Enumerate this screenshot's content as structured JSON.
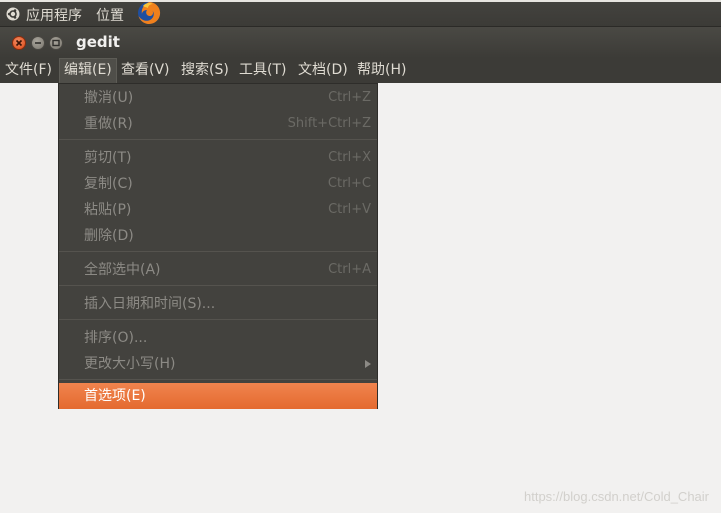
{
  "top_panel": {
    "applications": "应用程序",
    "places": "位置",
    "launcher_icon": "firefox-icon"
  },
  "window": {
    "title": "gedit",
    "buttons": [
      "close-icon",
      "minimize-icon",
      "maximize-icon"
    ]
  },
  "menubar": {
    "items": [
      {
        "label": "文件(F)"
      },
      {
        "label": "编辑(E)"
      },
      {
        "label": "查看(V)"
      },
      {
        "label": "搜索(S)"
      },
      {
        "label": "工具(T)"
      },
      {
        "label": "文档(D)"
      },
      {
        "label": "帮助(H)"
      }
    ]
  },
  "edit_menu": {
    "items": [
      {
        "label": "撤消(U)",
        "shortcut": "Ctrl+Z",
        "enabled": false
      },
      {
        "label": "重做(R)",
        "shortcut": "Shift+Ctrl+Z",
        "enabled": false
      },
      {
        "label": "剪切(T)",
        "shortcut": "Ctrl+X",
        "enabled": false
      },
      {
        "label": "复制(C)",
        "shortcut": "Ctrl+C",
        "enabled": false
      },
      {
        "label": "粘贴(P)",
        "shortcut": "Ctrl+V",
        "enabled": false
      },
      {
        "label": "删除(D)",
        "shortcut": "",
        "enabled": false
      },
      {
        "label": "全部选中(A)",
        "shortcut": "Ctrl+A",
        "enabled": false
      },
      {
        "label": "插入日期和时间(S)...",
        "shortcut": "",
        "enabled": false
      },
      {
        "label": "排序(O)...",
        "shortcut": "",
        "enabled": false
      },
      {
        "label": "更改大小写(H)",
        "shortcut": "",
        "enabled": false,
        "submenu": true
      },
      {
        "label": "首选项(E)",
        "shortcut": "",
        "enabled": true,
        "highlighted": true
      }
    ]
  },
  "watermark": "https://blog.csdn.net/Cold_Chair",
  "colors": {
    "accent": "#e9703a",
    "panel": "#3c3b37",
    "background": "#f2f1f0"
  }
}
